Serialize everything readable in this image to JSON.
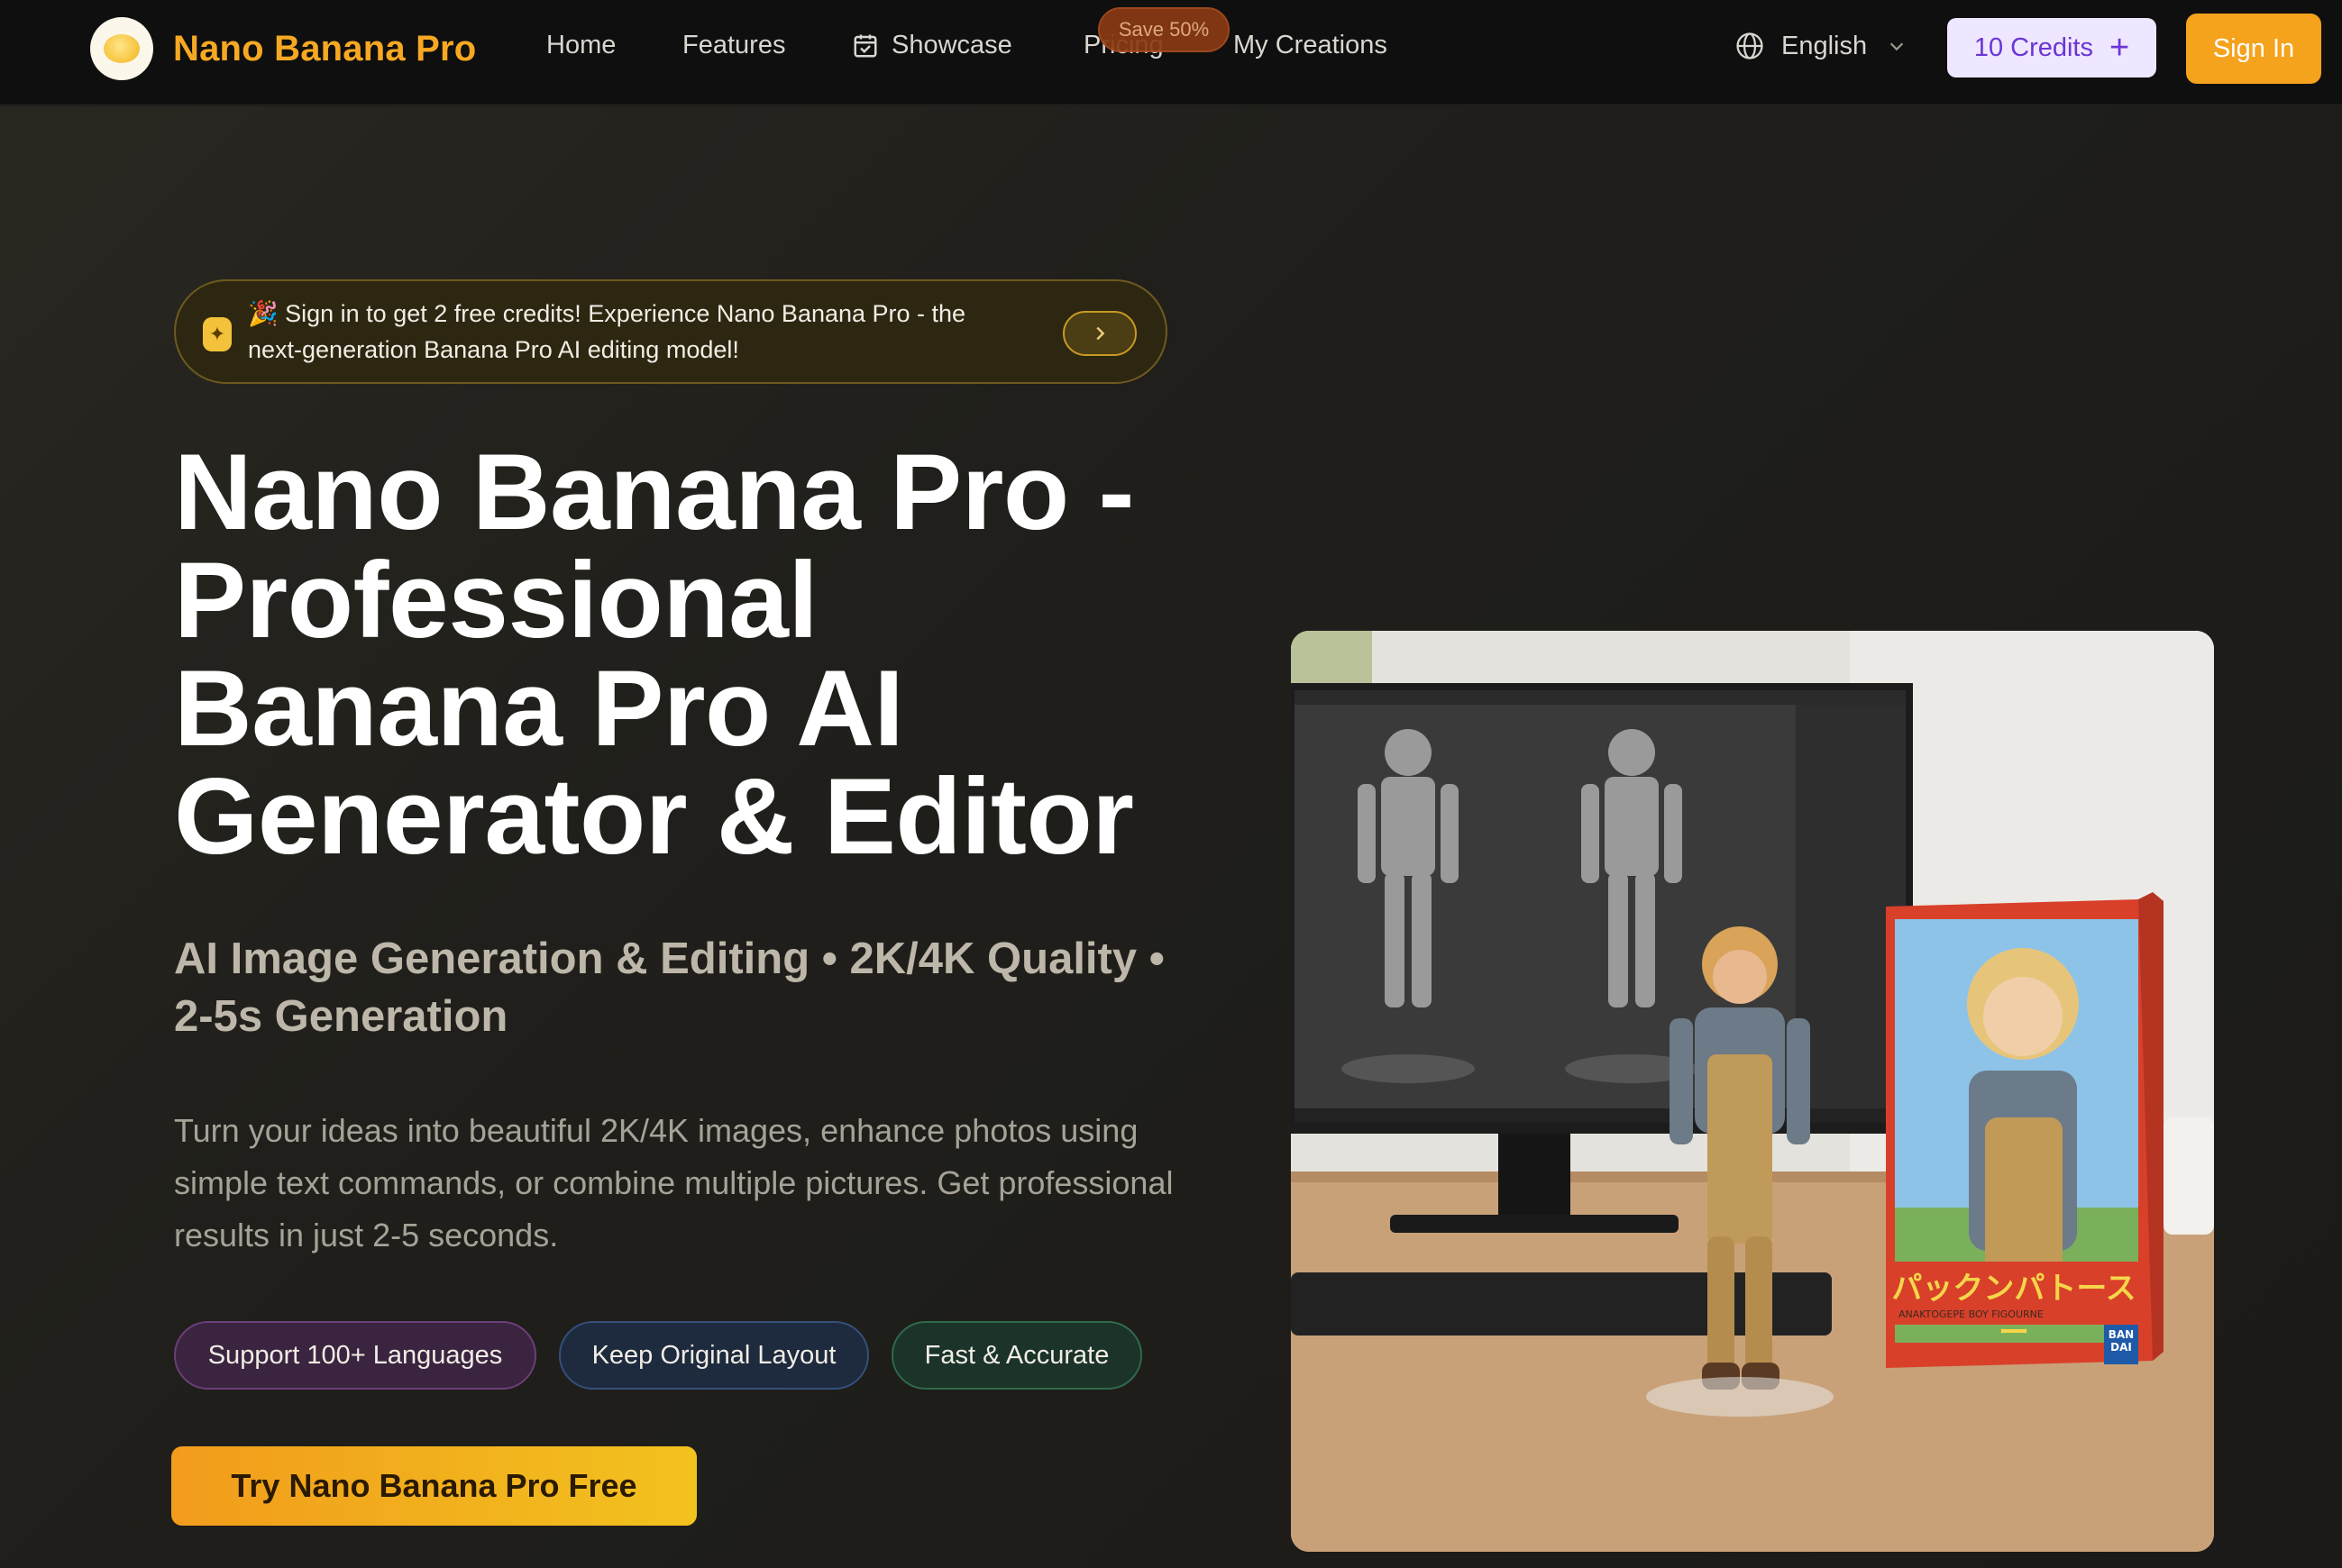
{
  "brand": {
    "name": "Nano Banana Pro"
  },
  "nav": {
    "links": [
      {
        "label": "Home"
      },
      {
        "label": "Features"
      },
      {
        "label": "Showcase",
        "icon": "calendar-grid-icon"
      },
      {
        "label": "Pricing",
        "badge": "Save 50%"
      },
      {
        "label": "My Creations"
      }
    ],
    "language": "English",
    "credits_label": "10 Credits",
    "signin_label": "Sign In"
  },
  "announcement": {
    "text": "🎉 Sign in to get 2 free credits! Experience Nano Banana Pro - the next-generation Banana Pro AI editing model!"
  },
  "hero": {
    "title": "Nano Banana Pro - Professional Banana Pro AI Generator & Editor",
    "subtitle": "AI Image Generation & Editing • 2K/4K Quality • 2-5s Generation",
    "description": "Turn your ideas into beautiful 2K/4K images, enhance photos using simple text commands, or combine multiple pictures. Get professional results in just 2-5 seconds.",
    "chips": [
      "Support 100+ Languages",
      "Keep Original Layout",
      "Fast & Accurate"
    ],
    "cta_label": "Try Nano Banana Pro Free"
  },
  "hero_image": {
    "box_title_jp": "パックンパトースー",
    "box_brand": "BAN DAI",
    "box_caption": "ANAKTOGEPE BOY FIGOURNE"
  },
  "colors": {
    "accent_orange": "#f7a823",
    "credits_bg": "#efe6ff",
    "credits_text": "#6a36d6",
    "background": "#1a1917"
  }
}
